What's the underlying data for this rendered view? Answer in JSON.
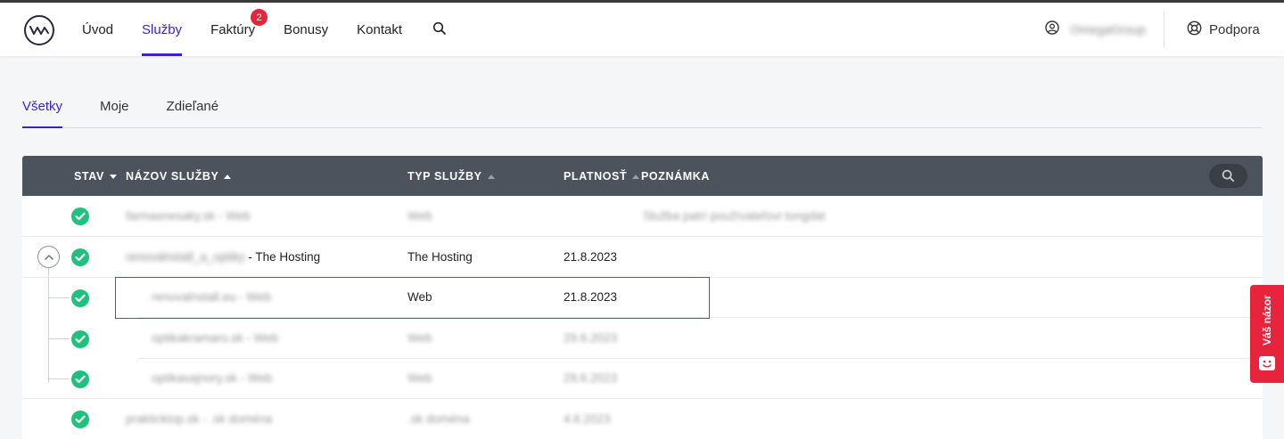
{
  "header": {
    "nav": [
      {
        "label": "Úvod"
      },
      {
        "label": "Služby",
        "active": true
      },
      {
        "label": "Faktúry",
        "badge": "2"
      },
      {
        "label": "Bonusy"
      },
      {
        "label": "Kontakt"
      }
    ],
    "user_name": "OmegaGroup",
    "support_label": "Podpora"
  },
  "tabs": [
    {
      "label": "Všetky",
      "active": true
    },
    {
      "label": "Moje"
    },
    {
      "label": "Zdieľané"
    }
  ],
  "table": {
    "columns": {
      "status": "STAV",
      "name": "NÁZOV SLUŽBY",
      "type": "TYP SLUŽBY",
      "validity": "PLATNOSŤ",
      "note": "POZNÁMKA"
    },
    "rows": [
      {
        "name": "farmasnesaky.sk - Web",
        "suffix": "",
        "type": "Web",
        "validity": "",
        "note": "Služba patrí používateľovi tongdat"
      },
      {
        "name": "renovalnstall_a_optiky",
        "suffix": "- The Hosting",
        "type": "The Hosting",
        "validity": "21.8.2023",
        "note": ""
      },
      {
        "name": "renovalnstall.eu - Web",
        "suffix": "",
        "type": "Web",
        "validity": "21.8.2023",
        "note": ""
      },
      {
        "name": "optikakramaro.sk - Web",
        "suffix": "",
        "type": "Web",
        "validity": "29.6.2023",
        "note": ""
      },
      {
        "name": "optikasajnory.sk - Web",
        "suffix": "",
        "type": "Web",
        "validity": "29.6.2023",
        "note": ""
      },
      {
        "name": "prakticktop.sk - .sk doména",
        "suffix": "",
        "type": ".sk doména",
        "validity": "4.6.2023",
        "note": ""
      }
    ]
  },
  "feedback_label": "Váš názor",
  "colors": {
    "accent": "#3b1fd6",
    "status_ok": "#1fc17c",
    "badge": "#e8243d",
    "table_header": "#4d535c",
    "highlight": "#c9302c"
  }
}
